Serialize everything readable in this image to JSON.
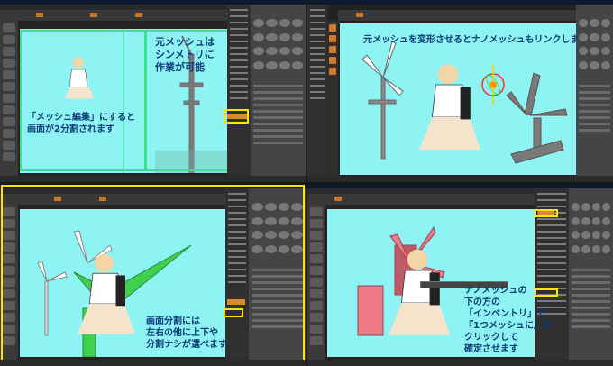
{
  "panels": {
    "top_left": {
      "caption_left": [
        "「メッシュ編集」にすると",
        "画面が2分割されます"
      ],
      "caption_right": [
        "元メッシュは",
        "シンメトリに",
        "作業が可能"
      ]
    },
    "top_right": {
      "caption": "元メッシュを変形させるとナノメッシュもリンクします"
    },
    "bottom_left": {
      "caption": [
        "画面分割には",
        "左右の他に上下や",
        "分割ナシが選べます"
      ]
    },
    "bottom_right": {
      "caption": [
        "ナノメッシュの",
        "下の方の",
        "「インベントリ」で",
        "『1つメッシュに』を",
        "クリックして",
        "確定させます"
      ]
    }
  },
  "colors": {
    "viewport_bg": "#8ef3f3",
    "highlight_yellow": "#ffe400",
    "highlight_green": "#3ce08d",
    "accent_orange": "#d88a2e",
    "model_green": "#3fd04f",
    "model_pink": "#f07a86"
  },
  "icons": {
    "gizmo": "transform-gizmo-icon",
    "brush": "brush-ball-icon"
  }
}
